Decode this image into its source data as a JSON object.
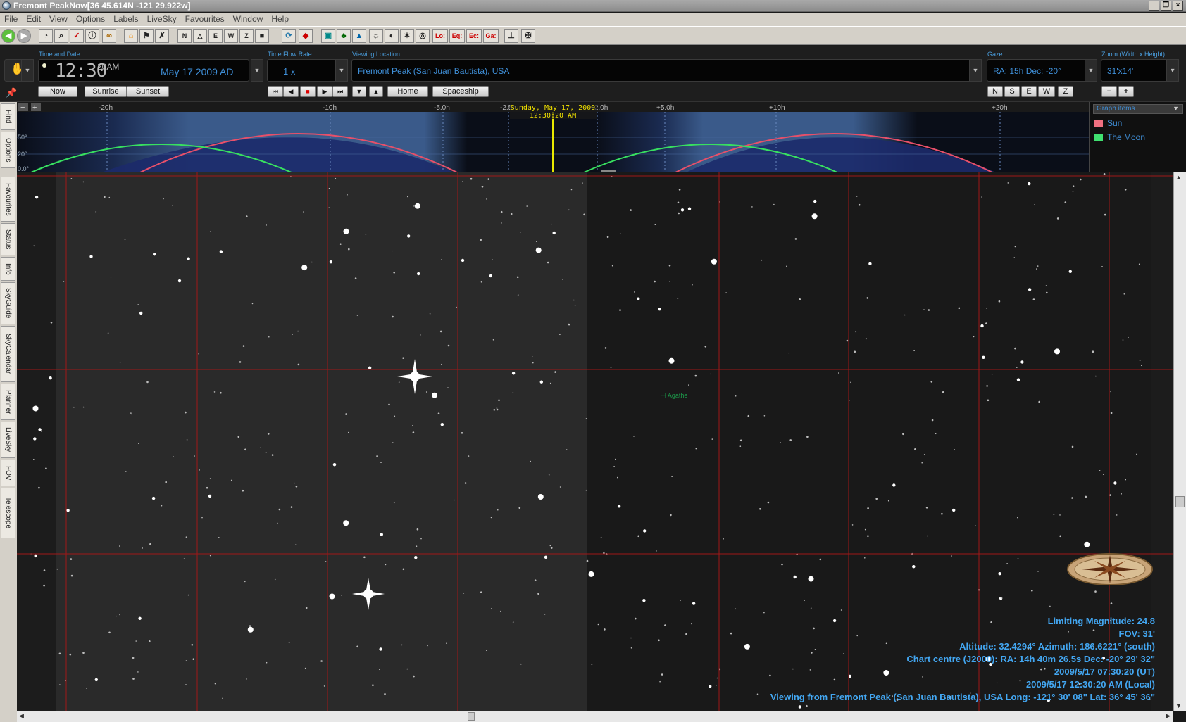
{
  "window": {
    "title": "Fremont PeakNow[36  45.614N  -121 29.922w]",
    "controls": [
      "_",
      "❐",
      "×"
    ]
  },
  "menu": [
    "File",
    "Edit",
    "View",
    "Options",
    "Labels",
    "LiveSky",
    "Favourites",
    "Window",
    "Help"
  ],
  "toolbar": {
    "icons": [
      "back-icon",
      "forward-icon",
      "clock-icon",
      "zoom-icon",
      "checklist-icon",
      "info-icon",
      "binoculars-icon",
      "home-icon",
      "flag-icon",
      "star-flag-icon",
      "north-icon",
      "northeast-icon",
      "east-icon",
      "west-icon",
      "zenith-icon",
      "stop-icon",
      "refresh-icon",
      "diamond-icon",
      "sky-icon",
      "tree-icon",
      "mountain-icon",
      "sun-icon",
      "moon-icon",
      "constellation-icon",
      "galaxy-icon",
      "lo-icon",
      "eq-icon",
      "ec-icon",
      "ga-icon",
      "telescope-icon",
      "mount-icon"
    ],
    "text_buttons": [
      "Lo:",
      "Eq:",
      "Ec:",
      "Ga:"
    ]
  },
  "time_date": {
    "label": "Time and Date",
    "time": "12:30",
    "seconds_ampm": "20AM",
    "date": "May 17   2009 AD",
    "buttons": [
      "Now",
      "Sunrise",
      "Sunset"
    ]
  },
  "time_flow": {
    "label": "Time Flow Rate",
    "value": "1 x",
    "controls": [
      "⏮",
      "◀",
      "■",
      "▶",
      "⏭"
    ]
  },
  "location": {
    "label": "Viewing Location",
    "value": "Fremont Peak (San Juan Bautista), USA",
    "buttons": [
      "Home",
      "Spaceship"
    ]
  },
  "gaze": {
    "label": "Gaze",
    "value": "RA: 15h Dec: -20°",
    "dirs": [
      "N",
      "S",
      "E",
      "W",
      "Z"
    ]
  },
  "zoom": {
    "label": "Zoom (Width x Height)",
    "value": "31'x14'",
    "buttons": [
      "−",
      "+"
    ]
  },
  "side_tabs": [
    "Find",
    "Options",
    "Favourites",
    "Status",
    "Info",
    "SkyGuide",
    "SkyCalendar",
    "Planner",
    "LiveSky",
    "FOV",
    "Telescope"
  ],
  "timeline": {
    "ticks": [
      "-20h",
      "-10h",
      "-5.0h",
      "-2.5h",
      "+2.0h",
      "+5.0h",
      "+10h",
      "+20h"
    ],
    "current_day": "Sunday, May 17, 2009",
    "current_time": "12:30:20 AM",
    "alt_labels": [
      "50°",
      "20°",
      "0.0°"
    ],
    "graph_title": "Graph items",
    "legend": [
      {
        "label": "Sun",
        "color": "#f07080"
      },
      {
        "label": "The Moon",
        "color": "#40e070"
      }
    ]
  },
  "sky": {
    "object_label": "Agathe",
    "info_lines": [
      "Limiting Magnitude: 24.8",
      "FOV: 31'",
      "Altitude: 32.4294° Azimuth: 186.6221° (south)",
      "Chart centre (J2000): RA: 14h 40m 26.5s Dec: -20° 29' 32\"",
      "2009/5/17 07:30:20 (UT)",
      "2009/5/17 12:30:20 AM (Local)",
      "Viewing from Fremont Peak (San Juan Bautista), USA    Long: -121° 30' 08\" Lat: 36° 45' 36\""
    ]
  }
}
